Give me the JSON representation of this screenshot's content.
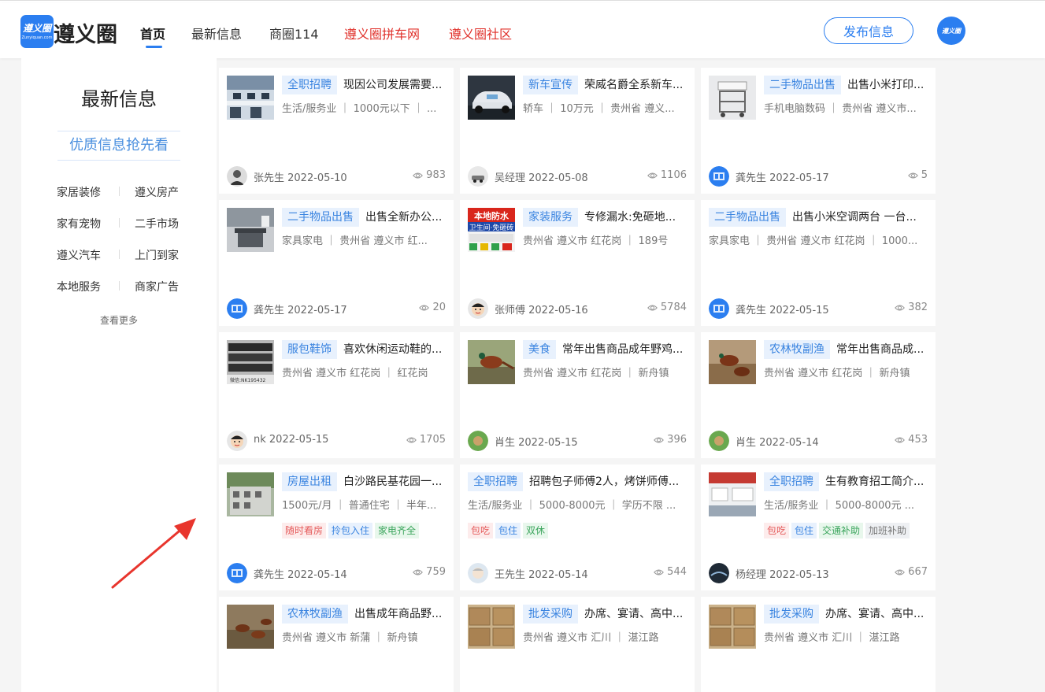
{
  "header": {
    "logo_icon_text": "遵义圈",
    "logo_icon_sub": "Zunyiquan.com",
    "logo_text": "遵义圈",
    "nav": [
      {
        "label": "首页"
      },
      {
        "label": "最新信息"
      },
      {
        "label": "商圈114"
      },
      {
        "label": "遵义圈拼车网"
      },
      {
        "label": "遵义圈社区"
      }
    ],
    "publish_label": "发布信息",
    "avatar_text": "遵义圈"
  },
  "sidebar": {
    "title": "最新信息",
    "subtitle": "优质信息抢先看",
    "categories": [
      "家居装修",
      "遵义房产",
      "家有宠物",
      "二手市场",
      "遵义汽车",
      "上门到家",
      "本地服务",
      "商家广告"
    ],
    "more_label": "查看更多"
  },
  "colors": {
    "accent": "#2b7ef0",
    "nav_red": "#e0302a",
    "tag_bg": "#e8f1fd",
    "arrow": "#e8352d"
  },
  "cards": [
    {
      "tag": "全职招聘",
      "title": "现因公司发展需要...",
      "meta": "生活/服务业 ｜ 1000元以下 ｜ ...",
      "chips": [],
      "author": "张先生 2022-05-10",
      "views": "983",
      "thumb": "office",
      "avatar": "person"
    },
    {
      "tag": "新车宣传",
      "title": "荣威名爵全系新车...",
      "meta": "轿车 ｜ 10万元 ｜ 贵州省 遵义...",
      "chips": [],
      "author": "吴经理 2022-05-08",
      "views": "1106",
      "thumb": "car",
      "avatar": "car"
    },
    {
      "tag": "二手物品出售",
      "title": "出售小米打印...",
      "meta": "手机电脑数码 ｜ 贵州省 遵义市...",
      "chips": [],
      "author": "龚先生 2022-05-17",
      "views": "5",
      "thumb": "cart",
      "avatar": "logo"
    },
    {
      "tag": "二手物品出售",
      "title": "出售全新办公...",
      "meta": "家具家电 ｜ 贵州省 遵义市 红...",
      "chips": [],
      "author": "龚先生 2022-05-17",
      "views": "20",
      "thumb": "desk",
      "avatar": "logo"
    },
    {
      "tag": "家装服务",
      "title": "专修漏水:免砸地...",
      "meta": "贵州省 遵义市 红花岗 ｜ 189号",
      "chips": [],
      "author": "张师傅 2022-05-16",
      "views": "5784",
      "thumb": "ad",
      "avatar": "cartoon"
    },
    {
      "tag": "二手物品出售",
      "title": "出售小米空调两台 一台...",
      "meta": "家具家电 ｜ 贵州省 遵义市 红花岗 ｜ 1000...",
      "chips": [],
      "author": "龚先生 2022-05-15",
      "views": "382",
      "thumb": "none",
      "avatar": "logo"
    },
    {
      "tag": "服包鞋饰",
      "title": "喜欢休闲运动鞋的...",
      "meta": "贵州省 遵义市 红花岗 ｜ 红花岗",
      "chips": [],
      "author": "nk 2022-05-15",
      "views": "1705",
      "thumb": "shoes",
      "avatar": "cartoon"
    },
    {
      "tag": "美食",
      "title": "常年出售商品成年野鸡...",
      "meta": "贵州省 遵义市 红花岗 ｜ 新舟镇",
      "chips": [],
      "author": "肖生 2022-05-15",
      "views": "396",
      "thumb": "pheasant",
      "avatar": "green"
    },
    {
      "tag": "农林牧副渔",
      "title": "常年出售商品成...",
      "meta": "贵州省 遵义市 红花岗 ｜ 新舟镇",
      "chips": [],
      "author": "肖生 2022-05-14",
      "views": "453",
      "thumb": "pheasant2",
      "avatar": "green"
    },
    {
      "tag": "房屋出租",
      "title": "白沙路民基花园一...",
      "meta": "1500元/月 ｜ 普通住宅 ｜ 半年...",
      "chips": [
        {
          "label": "随时看房",
          "color": "red"
        },
        {
          "label": "拎包入住",
          "color": "blue"
        },
        {
          "label": "家电齐全",
          "color": "green"
        }
      ],
      "author": "龚先生 2022-05-14",
      "views": "759",
      "thumb": "building",
      "avatar": "logo"
    },
    {
      "tag": "全职招聘",
      "title": "招聘包子师傅2人，烤饼师傅...",
      "meta": "生活/服务业 ｜ 5000-8000元 ｜ 学历不限 ...",
      "chips": [
        {
          "label": "包吃",
          "color": "red"
        },
        {
          "label": "包住",
          "color": "blue"
        },
        {
          "label": "双休",
          "color": "green"
        }
      ],
      "author": "王先生 2022-05-14",
      "views": "544",
      "thumb": "none",
      "avatar": "baby"
    },
    {
      "tag": "全职招聘",
      "title": "生有教育招工简介...",
      "meta": "生活/服务业 ｜ 5000-8000元 ...",
      "chips": [
        {
          "label": "包吃",
          "color": "red"
        },
        {
          "label": "包住",
          "color": "blue"
        },
        {
          "label": "交通补助",
          "color": "green"
        },
        {
          "label": "加班补助",
          "color": "gray"
        }
      ],
      "author": "杨经理 2022-05-13",
      "views": "667",
      "thumb": "classroom",
      "avatar": "dark"
    },
    {
      "tag": "农林牧副渔",
      "title": "出售成年商品野...",
      "meta": "贵州省 遵义市 新蒲 ｜ 新舟镇",
      "chips": [],
      "author": "",
      "views": "",
      "thumb": "pheasant3",
      "avatar": "none"
    },
    {
      "tag": "批发采购",
      "title": "办席、宴请、高中...",
      "meta": "贵州省 遵义市 汇川 ｜ 湛江路",
      "chips": [],
      "author": "",
      "views": "",
      "thumb": "boxes",
      "avatar": "none"
    },
    {
      "tag": "批发采购",
      "title": "办席、宴请、高中...",
      "meta": "贵州省 遵义市 汇川 ｜ 湛江路",
      "chips": [],
      "author": "",
      "views": "",
      "thumb": "boxes",
      "avatar": "none"
    }
  ]
}
